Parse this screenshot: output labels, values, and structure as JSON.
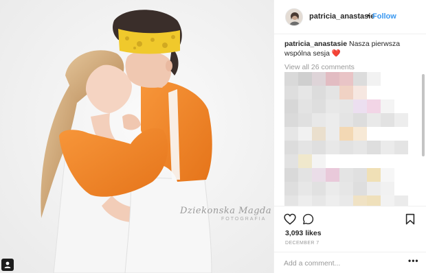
{
  "post": {
    "username": "patricia_anastasie",
    "follow_label": "Follow",
    "separator": "•",
    "caption_user": "patricia_anastasie",
    "caption_text": "Nasza pierwsza wspólna sesja",
    "caption_emoji": "❤️",
    "view_all_label": "View all 26 comments",
    "likes_label": "3,093 likes",
    "date_label": "DECEMBER 7",
    "comment_placeholder": "Add a comment...",
    "more_label": "•••"
  },
  "photo": {
    "watermark": "Dziekonska Magda",
    "watermark_sub": "FOTOGRAFIA"
  },
  "icons": {
    "like": "heart-outline-icon",
    "comment": "speech-bubble-icon",
    "save": "bookmark-icon",
    "tag": "user-tag-icon"
  },
  "colors": {
    "follow": "#3897f0",
    "text": "#262626",
    "muted": "#999999",
    "orange_shirt": "#f2872a",
    "bandana": "#f0c92c"
  }
}
